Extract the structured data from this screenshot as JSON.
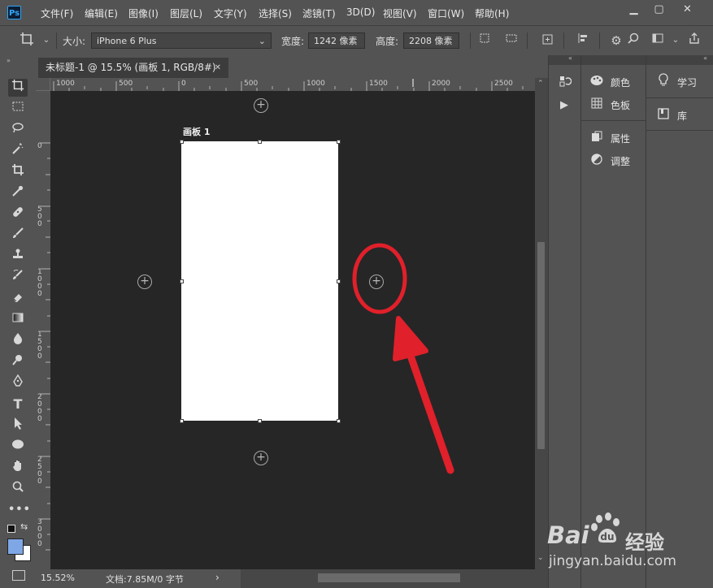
{
  "app": {
    "logo": "Ps"
  },
  "menu": [
    "文件(F)",
    "编辑(E)",
    "图像(I)",
    "图层(L)",
    "文字(Y)",
    "选择(S)",
    "滤镜(T)",
    "3D(D)",
    "视图(V)",
    "窗口(W)",
    "帮助(H)"
  ],
  "window_controls": {
    "minimize": "▁",
    "maximize": "▢",
    "close": "✕"
  },
  "options": {
    "size_label": "大小:",
    "size_value": "iPhone 6 Plus",
    "width_label": "宽度:",
    "width_value": "1242 像素",
    "height_label": "高度:",
    "height_value": "2208 像素"
  },
  "document": {
    "tab_title": "未标题-1 @ 15.5% (画板 1, RGB/8#)",
    "tab_close": "✕",
    "artboard_label": "画板 1"
  },
  "ruler": {
    "h_ticks": [
      "1000",
      "500",
      "0",
      "500",
      "1000",
      "1500",
      "2000",
      "2500"
    ],
    "v_ticks": [
      "0",
      "5\n0\n0",
      "1\n0\n0\n0",
      "1\n5\n0\n0",
      "2\n0\n0\n0",
      "2\n5\n0\n0",
      "3\n0\n0\n0"
    ]
  },
  "status": {
    "zoom": "15.52%",
    "doc_info": "文档:7.85M/0 字节",
    "arrow": "›"
  },
  "panels": {
    "col1": [
      {
        "icon": "palette-icon",
        "label": "颜色"
      },
      {
        "icon": "grid-icon",
        "label": "色板"
      },
      {
        "icon": "properties-icon",
        "label": "属性"
      },
      {
        "icon": "adjust-icon",
        "label": "调整"
      }
    ],
    "col2": [
      {
        "icon": "bulb-icon",
        "label": "学习"
      },
      {
        "icon": "library-icon",
        "label": "库"
      }
    ]
  },
  "watermark": {
    "brand": "Bai",
    "brand2": "经验",
    "url": "jingyan.baidu.com"
  },
  "colors": {
    "accent_annotation": "#e0202a",
    "foreground_swatch": "#7fa7e6",
    "background_swatch": "#ffffff"
  }
}
